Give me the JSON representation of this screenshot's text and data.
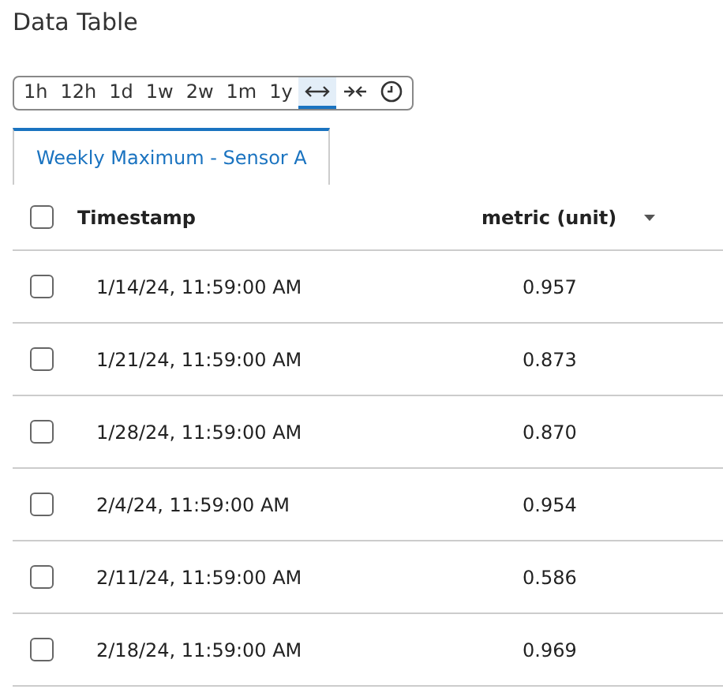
{
  "title": "Data Table",
  "range_buttons": [
    {
      "kind": "text",
      "label": "1h",
      "selected": false
    },
    {
      "kind": "text",
      "label": "12h",
      "selected": false
    },
    {
      "kind": "text",
      "label": "1d",
      "selected": false
    },
    {
      "kind": "text",
      "label": "1w",
      "selected": false
    },
    {
      "kind": "text",
      "label": "2w",
      "selected": false
    },
    {
      "kind": "text",
      "label": "1m",
      "selected": false
    },
    {
      "kind": "text",
      "label": "1y",
      "selected": false
    },
    {
      "kind": "expand",
      "selected": true
    },
    {
      "kind": "collapse",
      "selected": false
    },
    {
      "kind": "clock",
      "selected": false
    }
  ],
  "tabs": [
    {
      "label": "Weekly Maximum - Sensor A",
      "selected": true
    }
  ],
  "table": {
    "header_checked": false,
    "columns": [
      "Timestamp",
      "metric (unit)"
    ],
    "rows": [
      {
        "checked": false,
        "cells": [
          "1/14/24, 11:59:00 AM",
          "0.957"
        ]
      },
      {
        "checked": false,
        "cells": [
          "1/21/24, 11:59:00 AM",
          "0.873"
        ]
      },
      {
        "checked": false,
        "cells": [
          "1/28/24, 11:59:00 AM",
          "0.870"
        ]
      },
      {
        "checked": false,
        "cells": [
          "2/4/24, 11:59:00 AM",
          "0.954"
        ]
      },
      {
        "checked": false,
        "cells": [
          "2/11/24, 11:59:00 AM",
          "0.586"
        ]
      },
      {
        "checked": false,
        "cells": [
          "2/18/24, 11:59:00 AM",
          "0.969"
        ]
      }
    ]
  }
}
